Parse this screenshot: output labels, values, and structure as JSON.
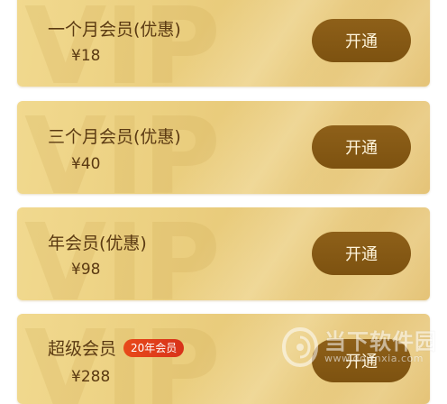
{
  "watermark_text": "VIP",
  "cards": [
    {
      "title": "一个月会员(优惠)",
      "price": "¥18",
      "button": "开通",
      "badge": ""
    },
    {
      "title": "三个月会员(优惠)",
      "price": "¥40",
      "button": "开通",
      "badge": ""
    },
    {
      "title": "年会员(优惠)",
      "price": "¥98",
      "button": "开通",
      "badge": ""
    },
    {
      "title": "超级会员",
      "price": "¥288",
      "button": "开通",
      "badge": "20年会员"
    }
  ],
  "site_watermark": {
    "name": "当下软件园",
    "url": "www.downxia.com"
  },
  "colors": {
    "card_gold": "#ecd182",
    "button_brown": "#8e6019",
    "text_brown": "#5b3a12",
    "badge_red": "#e84a1a"
  }
}
